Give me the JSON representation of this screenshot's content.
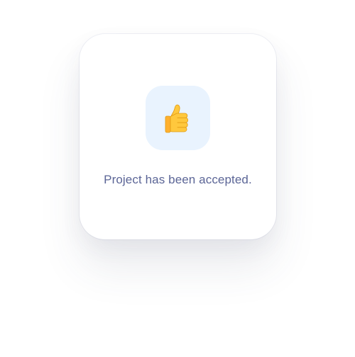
{
  "toast": {
    "icon": "thumbs-up-icon",
    "message": "Project has been accepted."
  },
  "colors": {
    "tile_background": "#e9f3fe",
    "message_text": "#5b6596",
    "thumb_fill": "#ffc83d",
    "thumb_shade": "#f0a71a"
  }
}
